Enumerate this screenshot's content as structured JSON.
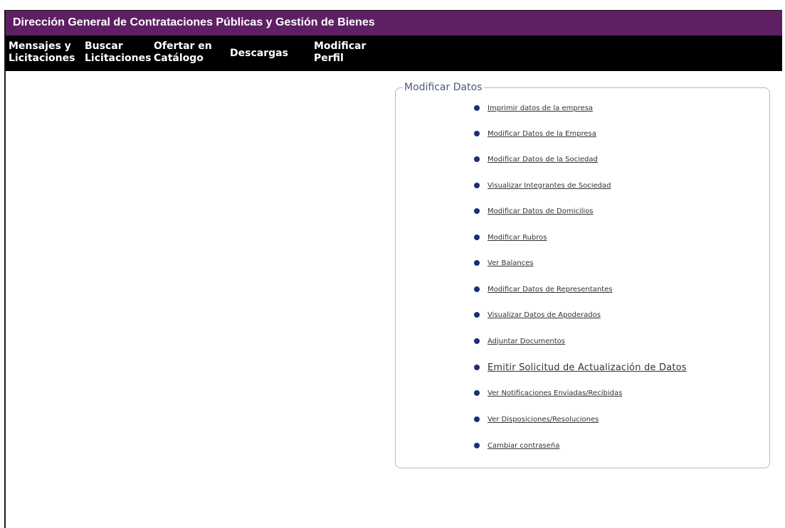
{
  "header": {
    "title": "Dirección General de Contrataciones Públicas y Gestión de Bienes",
    "background_color": "#5e1f64"
  },
  "nav": {
    "items": [
      {
        "label": "Mensajes y\nLicitaciones"
      },
      {
        "label": "Buscar\nLicitaciones"
      },
      {
        "label": "Ofertar en\nCatálogo"
      },
      {
        "label": "Descargas"
      },
      {
        "label": "Modificar\nPerfil"
      }
    ]
  },
  "panel": {
    "legend": "Modificar Datos",
    "links": [
      {
        "label": "Imprimir datos de la empresa"
      },
      {
        "label": "Modificar Datos de la Empresa"
      },
      {
        "label": "Modificar Datos de la Sociedad"
      },
      {
        "label": "Visualizar Integrantes de Sociedad"
      },
      {
        "label": "Modificar Datos de Domicilios"
      },
      {
        "label": "Modificar Rubros"
      },
      {
        "label": "Ver Balances"
      },
      {
        "label": "Modificar Datos de Representantes"
      },
      {
        "label": "Visualizar Datos de Apoderados"
      },
      {
        "label": "Adjuntar Documentos"
      },
      {
        "label": "Emitir Solicitud de Actualización de Datos"
      },
      {
        "label": "Ver Notificaciones Enviadas/Recibidas"
      },
      {
        "label": "Ver Disposiciones/Resoluciones"
      },
      {
        "label": "Cambiar contraseña"
      }
    ],
    "bullet_color": "#1c2f73"
  }
}
